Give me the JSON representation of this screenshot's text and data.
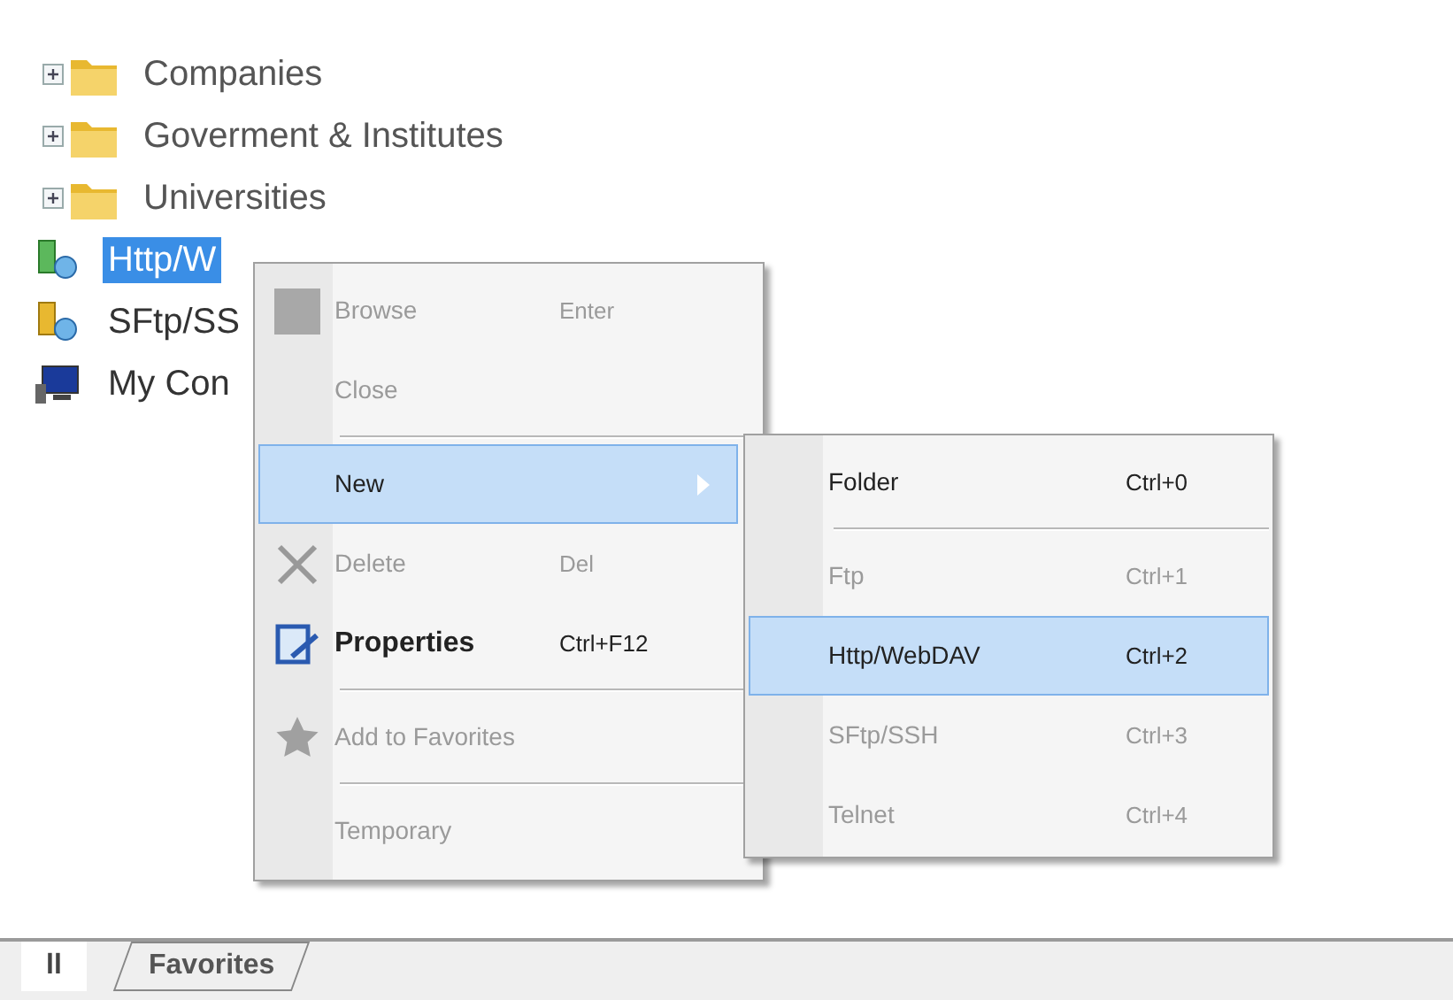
{
  "tree": {
    "items": [
      {
        "kind": "folder",
        "label": "Companies",
        "selected": false,
        "expandable": true
      },
      {
        "kind": "folder",
        "label": "Goverment & Institutes",
        "selected": false,
        "expandable": true
      },
      {
        "kind": "folder",
        "label": "Universities",
        "selected": false,
        "expandable": true
      },
      {
        "kind": "connection",
        "label": "Http/W",
        "selected": true,
        "expandable": false
      },
      {
        "kind": "secure",
        "label": "SFtp/SS",
        "selected": false,
        "expandable": false
      },
      {
        "kind": "computer",
        "label": "My Con",
        "selected": false,
        "expandable": false
      }
    ]
  },
  "context_menu": {
    "items": [
      {
        "kind": "item",
        "label": "Browse",
        "shortcut": "Enter",
        "disabled": true,
        "selected": false,
        "default": false
      },
      {
        "kind": "item",
        "label": "Close",
        "disabled": true,
        "selected": false,
        "default": false
      },
      {
        "kind": "separator"
      },
      {
        "kind": "submenu",
        "label": "New",
        "disabled": false,
        "selected": true,
        "default": false
      },
      {
        "kind": "item",
        "label": "Delete",
        "shortcut": "Del",
        "disabled": true,
        "selected": false,
        "default": false
      },
      {
        "kind": "item",
        "label": "Properties",
        "shortcut": "Ctrl+F12",
        "disabled": false,
        "selected": false,
        "default": true
      },
      {
        "kind": "separator"
      },
      {
        "kind": "item",
        "label": "Add to Favorites",
        "disabled": true,
        "selected": false,
        "default": false
      },
      {
        "kind": "separator"
      },
      {
        "kind": "item",
        "label": "Temporary",
        "disabled": true,
        "selected": false,
        "default": false
      }
    ]
  },
  "submenu": {
    "items": [
      {
        "kind": "item",
        "label": "Folder",
        "shortcut": "Ctrl+0",
        "disabled": false,
        "selected": false
      },
      {
        "kind": "separator"
      },
      {
        "kind": "item",
        "label": "Ftp",
        "shortcut": "Ctrl+1",
        "disabled": true,
        "selected": false
      },
      {
        "kind": "item",
        "label": "Http/WebDAV",
        "shortcut": "Ctrl+2",
        "disabled": false,
        "selected": true
      },
      {
        "kind": "item",
        "label": "SFtp/SSH",
        "shortcut": "Ctrl+3",
        "disabled": true,
        "selected": false
      },
      {
        "kind": "item",
        "label": "Telnet",
        "shortcut": "Ctrl+4",
        "disabled": true,
        "selected": false
      }
    ]
  },
  "tabs": [
    {
      "label": "ll",
      "selected": true
    },
    {
      "label": "Favorites",
      "selected": false
    }
  ]
}
